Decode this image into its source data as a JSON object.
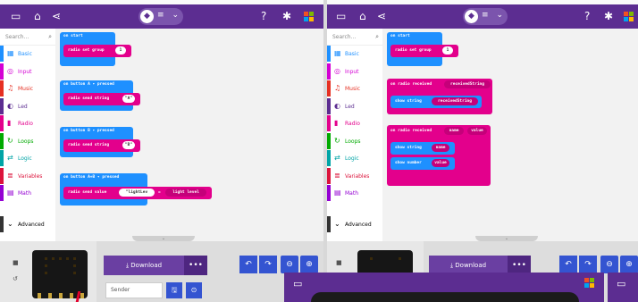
{
  "colors": {
    "menubar": "#5c2d91",
    "radio": "#e3008c",
    "basic": "#1e90ff",
    "download": "#6a3fa2",
    "toolbar_button": "#3454d1"
  },
  "icons": {
    "home": "home-icon",
    "share": "share-icon",
    "help": "help-icon",
    "settings": "gear-icon"
  },
  "left": {
    "search_placeholder": "Search...",
    "categories": [
      {
        "label": "Basic",
        "icon": "▦",
        "color": "#1e90ff"
      },
      {
        "label": "Input",
        "icon": "◎",
        "color": "#d400d4"
      },
      {
        "label": "Music",
        "icon": "♫",
        "color": "#e63022"
      },
      {
        "label": "Led",
        "icon": "◐",
        "color": "#5c2d91"
      },
      {
        "label": "Radio",
        "icon": "▮",
        "color": "#e3008c"
      },
      {
        "label": "Loops",
        "icon": "↻",
        "color": "#00aa00"
      },
      {
        "label": "Logic",
        "icon": "⇄",
        "color": "#00a4a6"
      },
      {
        "label": "Variables",
        "icon": "≣",
        "color": "#dc143c"
      },
      {
        "label": "Math",
        "icon": "▤",
        "color": "#9400d3"
      }
    ],
    "advanced_label": "Advanced",
    "blocks": {
      "on_start": "on start",
      "set_group": "radio set group",
      "group_value": "1",
      "on_button_a": "on button  A ▾  pressed",
      "send_string_1": "radio send string",
      "string_a": "\"A\"",
      "on_button_b": "on button  B ▾  pressed",
      "send_string_2": "radio send string",
      "string_b": "\"B\"",
      "on_button_ab": "on button  A+B ▾  pressed",
      "send_value": "radio send value",
      "value_name": "\"lightLev",
      "value_eq": "=",
      "value_light": "light level"
    },
    "download_label": "Download",
    "more_label": "•••",
    "name_value": "Sender",
    "save_icon": "🖫",
    "github_icon": "⊙"
  },
  "right": {
    "search_placeholder": "Search...",
    "categories": [
      {
        "label": "Basic",
        "icon": "▦",
        "color": "#1e90ff"
      },
      {
        "label": "Input",
        "icon": "◎",
        "color": "#d400d4"
      },
      {
        "label": "Music",
        "icon": "♫",
        "color": "#e63022"
      },
      {
        "label": "Led",
        "icon": "◐",
        "color": "#5c2d91"
      },
      {
        "label": "Radio",
        "icon": "▮",
        "color": "#e3008c"
      },
      {
        "label": "Loops",
        "icon": "↻",
        "color": "#00aa00"
      },
      {
        "label": "Logic",
        "icon": "⇄",
        "color": "#00a4a6"
      },
      {
        "label": "Variables",
        "icon": "≣",
        "color": "#dc143c"
      },
      {
        "label": "Math",
        "icon": "▤",
        "color": "#9400d3"
      }
    ],
    "advanced_label": "Advanced",
    "blocks": {
      "on_start": "on start",
      "set_group": "radio set group",
      "group_value": "1",
      "on_received_string": "on radio received",
      "received_string_var": "receivedString",
      "show_string_1": "show string",
      "show_string_1_var": "receivedString",
      "on_received_value": "on radio received",
      "name_var": "name",
      "value_var": "value",
      "show_string_2": "show string",
      "show_string_2_var": "name",
      "show_number": "show number",
      "show_number_var": "value"
    },
    "download_label": "Download",
    "more_label": "•••"
  }
}
